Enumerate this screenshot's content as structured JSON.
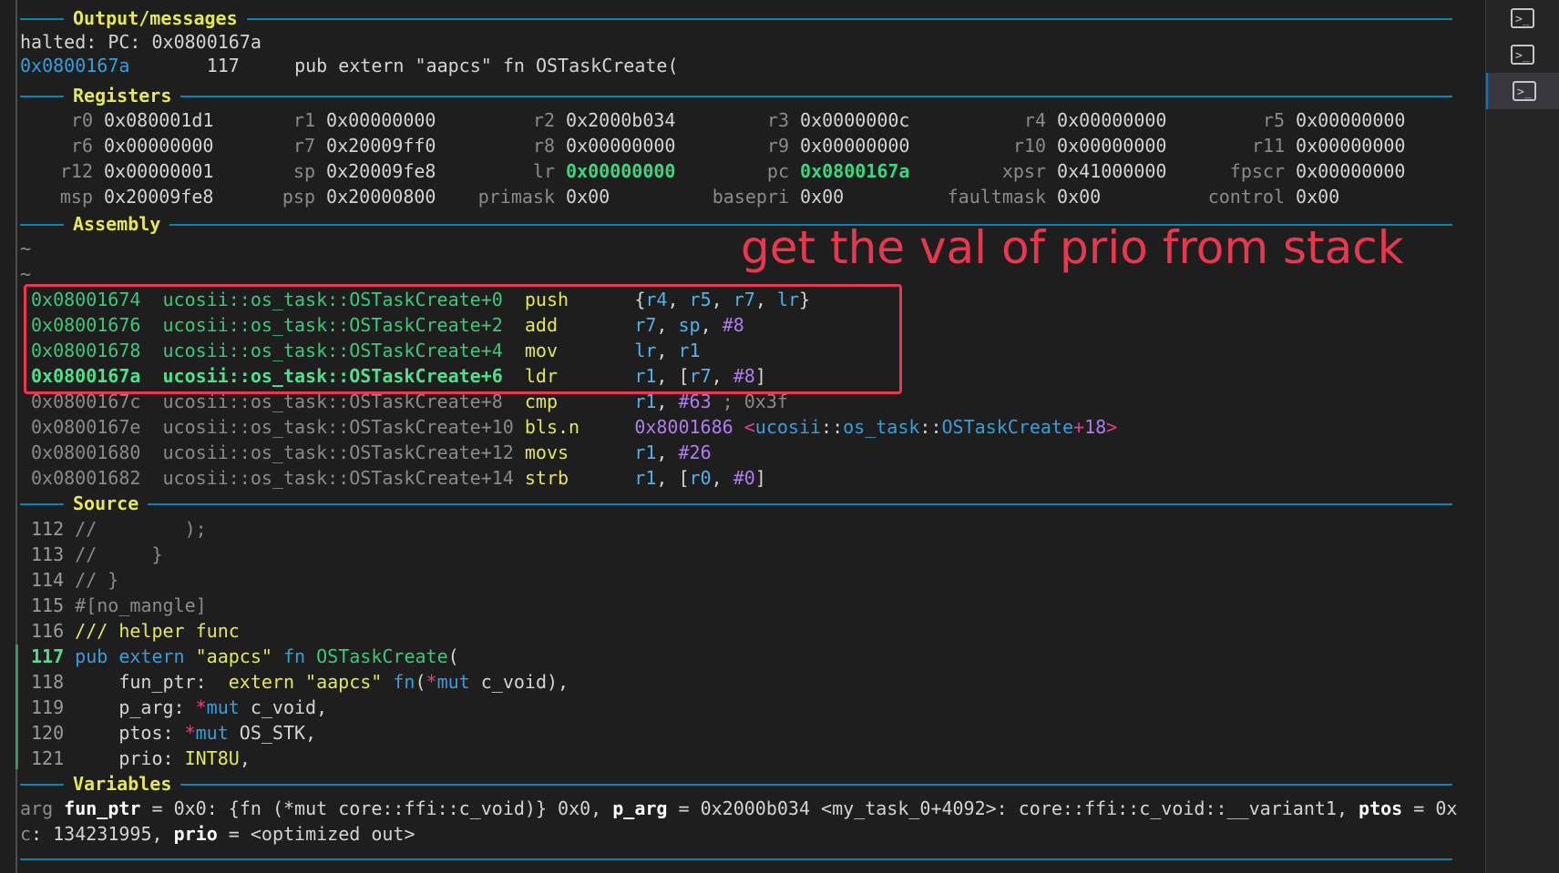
{
  "sections": {
    "output": "Output/messages",
    "registers": "Registers",
    "assembly": "Assembly",
    "source": "Source",
    "variables": "Variables"
  },
  "output": {
    "line1": "halted: PC: 0x0800167a",
    "addr": "0x0800167a",
    "lineno": "117",
    "code": "pub extern \"aapcs\" fn OSTaskCreate("
  },
  "registers": [
    [
      {
        "n": "r0",
        "v": "0x080001d1"
      },
      {
        "n": "r1",
        "v": "0x00000000"
      },
      {
        "n": "r2",
        "v": "0x2000b034"
      },
      {
        "n": "r3",
        "v": "0x0000000c"
      },
      {
        "n": "r4",
        "v": "0x00000000"
      },
      {
        "n": "r5",
        "v": "0x00000000"
      }
    ],
    [
      {
        "n": "r6",
        "v": "0x00000000"
      },
      {
        "n": "r7",
        "v": "0x20009ff0"
      },
      {
        "n": "r8",
        "v": "0x00000000"
      },
      {
        "n": "r9",
        "v": "0x00000000"
      },
      {
        "n": "r10",
        "v": "0x00000000"
      },
      {
        "n": "r11",
        "v": "0x00000000"
      }
    ],
    [
      {
        "n": "r12",
        "v": "0x00000001"
      },
      {
        "n": "sp",
        "v": "0x20009fe8"
      },
      {
        "n": "lr",
        "v": "0x00000000",
        "changed": true
      },
      {
        "n": "pc",
        "v": "0x0800167a",
        "changed": true
      },
      {
        "n": "xpsr",
        "v": "0x41000000"
      },
      {
        "n": "fpscr",
        "v": "0x00000000"
      }
    ],
    [
      {
        "n": "msp",
        "v": "0x20009fe8"
      },
      {
        "n": "psp",
        "v": "0x20000800"
      },
      {
        "n": "primask",
        "v": "0x00"
      },
      {
        "n": "basepri",
        "v": "0x00"
      },
      {
        "n": "faultmask",
        "v": "0x00"
      },
      {
        "n": "control",
        "v": "0x00"
      }
    ]
  ],
  "assembly": {
    "tildes": [
      "~",
      "~"
    ],
    "annotation": "get the val of prio from stack",
    "lines": [
      {
        "addr": "0x08001674",
        "func": "ucosii::os_task::OSTaskCreate+0",
        "mn": "push",
        "ops": [
          {
            "t": "{",
            "c": "p"
          },
          {
            "t": "r4",
            "c": "reg"
          },
          {
            "t": ", ",
            "c": "p"
          },
          {
            "t": "r5",
            "c": "reg"
          },
          {
            "t": ", ",
            "c": "p"
          },
          {
            "t": "r7",
            "c": "reg"
          },
          {
            "t": ", ",
            "c": "p"
          },
          {
            "t": "lr",
            "c": "reg"
          },
          {
            "t": "}",
            "c": "p"
          }
        ],
        "state": "recent"
      },
      {
        "addr": "0x08001676",
        "func": "ucosii::os_task::OSTaskCreate+2",
        "mn": "add",
        "ops": [
          {
            "t": "r7",
            "c": "reg"
          },
          {
            "t": ", ",
            "c": "p"
          },
          {
            "t": "sp",
            "c": "reg"
          },
          {
            "t": ", ",
            "c": "p"
          },
          {
            "t": "#8",
            "c": "imm"
          }
        ],
        "state": "recent"
      },
      {
        "addr": "0x08001678",
        "func": "ucosii::os_task::OSTaskCreate+4",
        "mn": "mov",
        "ops": [
          {
            "t": "lr",
            "c": "reg"
          },
          {
            "t": ", ",
            "c": "p"
          },
          {
            "t": "r1",
            "c": "reg"
          }
        ],
        "state": "recent"
      },
      {
        "addr": "0x0800167a",
        "func": "ucosii::os_task::OSTaskCreate+6",
        "mn": "ldr",
        "ops": [
          {
            "t": "r1",
            "c": "reg"
          },
          {
            "t": ", [",
            "c": "p"
          },
          {
            "t": "r7",
            "c": "reg"
          },
          {
            "t": ", ",
            "c": "p"
          },
          {
            "t": "#8",
            "c": "imm"
          },
          {
            "t": "]",
            "c": "p"
          }
        ],
        "state": "current"
      },
      {
        "addr": "0x0800167c",
        "func": "ucosii::os_task::OSTaskCreate+8",
        "mn": "cmp",
        "ops": [
          {
            "t": "r1",
            "c": "reg"
          },
          {
            "t": ", ",
            "c": "p"
          },
          {
            "t": "#63",
            "c": "imm"
          },
          {
            "t": " ; 0x3f",
            "c": "cmt"
          }
        ],
        "state": "future"
      },
      {
        "addr": "0x0800167e",
        "func": "ucosii::os_task::OSTaskCreate+10",
        "mn": "bls.n",
        "ops": [
          {
            "t": "0x8001686",
            "c": "imm"
          },
          {
            "t": " ",
            "c": "p"
          },
          {
            "t": "<",
            "c": "op"
          },
          {
            "t": "ucosii",
            "c": "sym"
          },
          {
            "t": "::",
            "c": "p"
          },
          {
            "t": "os_task",
            "c": "sym"
          },
          {
            "t": "::",
            "c": "p"
          },
          {
            "t": "OSTaskCreate",
            "c": "sym"
          },
          {
            "t": "+",
            "c": "op"
          },
          {
            "t": "18",
            "c": "imm"
          },
          {
            "t": ">",
            "c": "op"
          }
        ],
        "state": "future"
      },
      {
        "addr": "0x08001680",
        "func": "ucosii::os_task::OSTaskCreate+12",
        "mn": "movs",
        "ops": [
          {
            "t": "r1",
            "c": "reg"
          },
          {
            "t": ", ",
            "c": "p"
          },
          {
            "t": "#26",
            "c": "imm"
          }
        ],
        "state": "future"
      },
      {
        "addr": "0x08001682",
        "func": "ucosii::os_task::OSTaskCreate+14",
        "mn": "strb",
        "ops": [
          {
            "t": "r1",
            "c": "reg"
          },
          {
            "t": ", [",
            "c": "p"
          },
          {
            "t": "r0",
            "c": "reg"
          },
          {
            "t": ", ",
            "c": "p"
          },
          {
            "t": "#0",
            "c": "imm"
          },
          {
            "t": "]",
            "c": "p"
          }
        ],
        "state": "future"
      }
    ]
  },
  "source": [
    {
      "n": "112",
      "toks": [
        {
          "t": "//        );",
          "c": "cmt"
        }
      ]
    },
    {
      "n": "113",
      "toks": [
        {
          "t": "//     }",
          "c": "cmt"
        }
      ]
    },
    {
      "n": "114",
      "toks": [
        {
          "t": "// }",
          "c": "cmt"
        }
      ]
    },
    {
      "n": "115",
      "toks": [
        {
          "t": "#[no_mangle]",
          "c": "cmt"
        }
      ]
    },
    {
      "n": "116",
      "toks": [
        {
          "t": "/// helper func",
          "c": "str"
        }
      ]
    },
    {
      "n": "117",
      "cur": true,
      "toks": [
        {
          "t": "pub",
          "c": "kw"
        },
        {
          "t": " ",
          "c": "p"
        },
        {
          "t": "extern",
          "c": "kw"
        },
        {
          "t": " ",
          "c": "p"
        },
        {
          "t": "\"aapcs\"",
          "c": "str"
        },
        {
          "t": " ",
          "c": "p"
        },
        {
          "t": "fn",
          "c": "kw"
        },
        {
          "t": " ",
          "c": "p"
        },
        {
          "t": "OSTaskCreate",
          "c": "fn"
        },
        {
          "t": "(",
          "c": "p"
        }
      ]
    },
    {
      "n": "118",
      "toks": [
        {
          "t": "    fun_ptr:  ",
          "c": "p"
        },
        {
          "t": "extern",
          "c": "str"
        },
        {
          "t": " ",
          "c": "p"
        },
        {
          "t": "\"aapcs\"",
          "c": "str"
        },
        {
          "t": " ",
          "c": "p"
        },
        {
          "t": "fn",
          "c": "kw"
        },
        {
          "t": "(",
          "c": "p"
        },
        {
          "t": "*",
          "c": "ptr"
        },
        {
          "t": "mut",
          "c": "kw"
        },
        {
          "t": " c_void),",
          "c": "p"
        }
      ]
    },
    {
      "n": "119",
      "toks": [
        {
          "t": "    p_arg: ",
          "c": "p"
        },
        {
          "t": "*",
          "c": "ptr"
        },
        {
          "t": "mut",
          "c": "kw"
        },
        {
          "t": " c_void,",
          "c": "p"
        }
      ]
    },
    {
      "n": "120",
      "toks": [
        {
          "t": "    ptos: ",
          "c": "p"
        },
        {
          "t": "*",
          "c": "ptr"
        },
        {
          "t": "mut",
          "c": "kw"
        },
        {
          "t": " OS_STK,",
          "c": "p"
        }
      ]
    },
    {
      "n": "121",
      "toks": [
        {
          "t": "    prio: ",
          "c": "p"
        },
        {
          "t": "INT8U",
          "c": "type"
        },
        {
          "t": ",",
          "c": "p"
        }
      ]
    }
  ],
  "variables": [
    [
      {
        "t": "arg ",
        "c": "cmt"
      },
      {
        "t": "fun_ptr",
        "c": "bold"
      },
      {
        "t": " = 0x0: {fn (*mut core::ffi::c_void)} 0x0, ",
        "c": "p"
      },
      {
        "t": "p_arg",
        "c": "bold"
      },
      {
        "t": " = 0x2000b034 <my_task_0+4092>: core::ffi::c_void::__variant1, ",
        "c": "p"
      },
      {
        "t": "ptos",
        "c": "bold"
      },
      {
        "t": " = 0x",
        "c": "p"
      }
    ],
    [
      {
        "t": "c",
        "c": "cmt"
      },
      {
        "t": ": 134231995, ",
        "c": "p"
      },
      {
        "t": "prio",
        "c": "bold"
      },
      {
        "t": " = <optimized out>",
        "c": "p"
      }
    ]
  ],
  "sidebar": {
    "icons": [
      "terminal-icon",
      "terminal-icon",
      "terminal-icon"
    ],
    "active_index": 2,
    "glyph": ">_"
  },
  "colors": {
    "rule": "#0e82aa",
    "section_title": "#e6e65a",
    "annotation": "#e8384f",
    "changed_register": "#3fd47e"
  }
}
